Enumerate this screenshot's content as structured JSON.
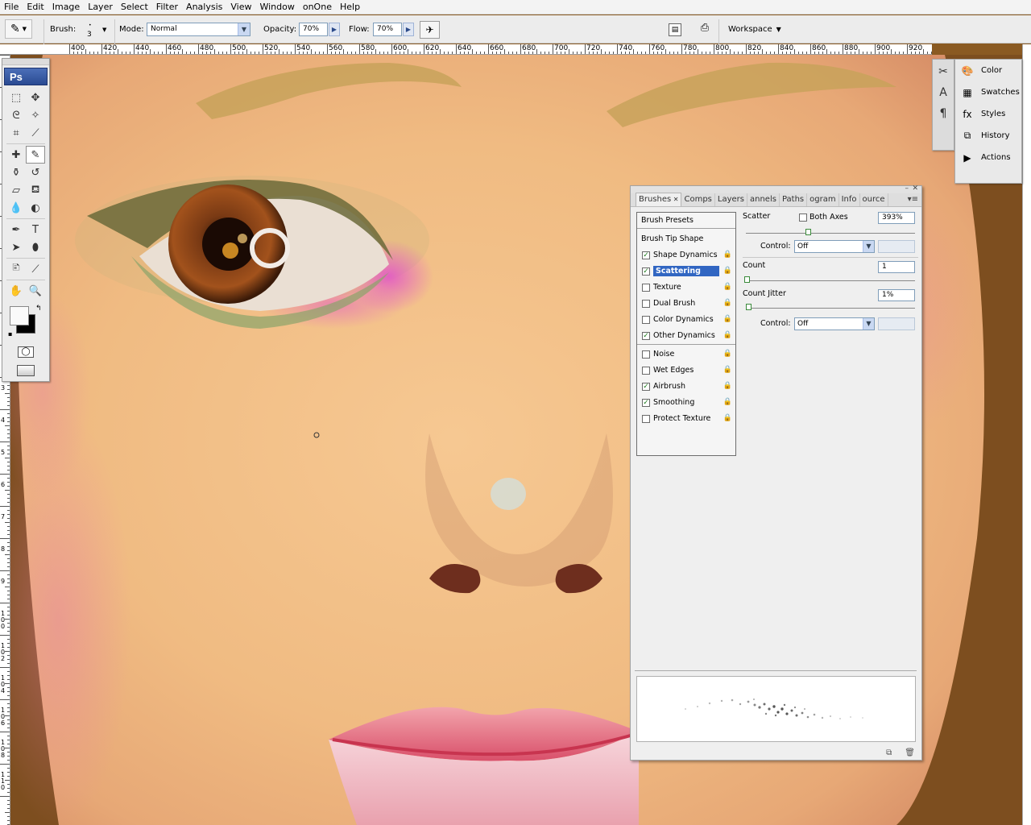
{
  "menu": [
    "File",
    "Edit",
    "Image",
    "Layer",
    "Select",
    "Filter",
    "Analysis",
    "View",
    "Window",
    "onOne",
    "Help"
  ],
  "options_bar": {
    "brush_label": "Brush:",
    "brush_size": "3",
    "mode_label": "Mode:",
    "mode_value": "Normal",
    "opacity_label": "Opacity:",
    "opacity_value": "70%",
    "flow_label": "Flow:",
    "flow_value": "70%",
    "workspace_label": "Workspace"
  },
  "ruler_top_labels": [
    "400",
    "420",
    "440",
    "460",
    "480",
    "500",
    "520",
    "540",
    "560",
    "580",
    "600",
    "620",
    "640",
    "660",
    "680",
    "700",
    "720",
    "740",
    "760",
    "780",
    "800",
    "820",
    "840",
    "860",
    "880",
    "900",
    "920"
  ],
  "ruler_left_labels": [
    "3",
    "4",
    "5",
    "6",
    "7",
    "8",
    "9",
    "1\n0\n0",
    "1\n0\n2",
    "1\n0\n4",
    "1\n0\n6",
    "1\n0\n8",
    "1\n1\n0"
  ],
  "toolbox": {
    "logo": "Ps",
    "tools": [
      {
        "name": "marquee-tool-icon",
        "glyph": "⬚"
      },
      {
        "name": "move-tool-icon",
        "glyph": "✥"
      },
      {
        "name": "lasso-tool-icon",
        "glyph": "ᘓ"
      },
      {
        "name": "magic-wand-tool-icon",
        "glyph": "✧"
      },
      {
        "name": "crop-tool-icon",
        "glyph": "⌗"
      },
      {
        "name": "eyedropper-slice-tool-icon",
        "glyph": "⟋"
      },
      {
        "name": "healing-brush-tool-icon",
        "glyph": "✚"
      },
      {
        "name": "brush-tool-icon",
        "glyph": "✎"
      },
      {
        "name": "clone-stamp-tool-icon",
        "glyph": "⚱"
      },
      {
        "name": "history-brush-tool-icon",
        "glyph": "↺"
      },
      {
        "name": "eraser-tool-icon",
        "glyph": "▱"
      },
      {
        "name": "paint-bucket-tool-icon",
        "glyph": "⛾"
      },
      {
        "name": "blur-tool-icon",
        "glyph": "💧"
      },
      {
        "name": "dodge-tool-icon",
        "glyph": "◐"
      },
      {
        "name": "pen-tool-icon",
        "glyph": "✒"
      },
      {
        "name": "type-tool-icon",
        "glyph": "T"
      },
      {
        "name": "path-selection-tool-icon",
        "glyph": "➤"
      },
      {
        "name": "shape-tool-icon",
        "glyph": "⬮"
      },
      {
        "name": "notes-tool-icon",
        "glyph": "🗈"
      },
      {
        "name": "eyedropper-tool-icon",
        "glyph": "⟋"
      },
      {
        "name": "hand-tool-icon",
        "glyph": "✋"
      },
      {
        "name": "zoom-tool-icon",
        "glyph": "🔍"
      }
    ],
    "foreground_color": "#fafafa",
    "background_color": "#000000"
  },
  "dock_icons": [
    {
      "name": "tool-presets-icon",
      "glyph": "✂"
    },
    {
      "name": "character-icon",
      "glyph": "A"
    },
    {
      "name": "paragraph-icon",
      "glyph": "¶"
    }
  ],
  "dock_panels": [
    {
      "label": "Color",
      "icon": "color-panel-icon",
      "glyph": "🎨"
    },
    {
      "label": "Swatches",
      "icon": "swatches-panel-icon",
      "glyph": "▦"
    },
    {
      "label": "Styles",
      "icon": "styles-panel-icon",
      "glyph": "fx"
    },
    {
      "label": "History",
      "icon": "history-panel-icon",
      "glyph": "⧉"
    },
    {
      "label": "Actions",
      "icon": "actions-panel-icon",
      "glyph": "▶"
    }
  ],
  "brushes_panel": {
    "tabs": [
      "Brushes",
      "Comps",
      "Layers",
      "annels",
      "Paths",
      "ogram",
      "Info",
      "ource"
    ],
    "active_tab": "Brushes",
    "presets_label": "Brush Presets",
    "tip_shape_label": "Brush Tip Shape",
    "options": [
      {
        "label": "Shape Dynamics",
        "checked": true,
        "selected": false
      },
      {
        "label": "Scattering",
        "checked": true,
        "selected": true
      },
      {
        "label": "Texture",
        "checked": false,
        "selected": false
      },
      {
        "label": "Dual Brush",
        "checked": false,
        "selected": false
      },
      {
        "label": "Color Dynamics",
        "checked": false,
        "selected": false
      },
      {
        "label": "Other Dynamics",
        "checked": true,
        "selected": false
      },
      {
        "label": "Noise",
        "checked": false,
        "selected": false
      },
      {
        "label": "Wet Edges",
        "checked": false,
        "selected": false
      },
      {
        "label": "Airbrush",
        "checked": true,
        "selected": false
      },
      {
        "label": "Smoothing",
        "checked": true,
        "selected": false
      },
      {
        "label": "Protect Texture",
        "checked": false,
        "selected": false
      }
    ],
    "scatter_label": "Scatter",
    "both_axes_label": "Both Axes",
    "both_axes_checked": false,
    "scatter_value": "393%",
    "scatter_level": 0.39,
    "control_label": "Control:",
    "control_value_1": "Off",
    "count_label": "Count",
    "count_value": "1",
    "count_level": 0.0,
    "count_jitter_label": "Count Jitter",
    "count_jitter_value": "1%",
    "count_jitter_level": 0.01,
    "control_value_2": "Off"
  },
  "colors": {
    "selection": "#3166c2",
    "ps_blue": "#2a4a92",
    "skin": "#f3c189",
    "background": "#8a5a22",
    "lip": "#e06b7c"
  }
}
